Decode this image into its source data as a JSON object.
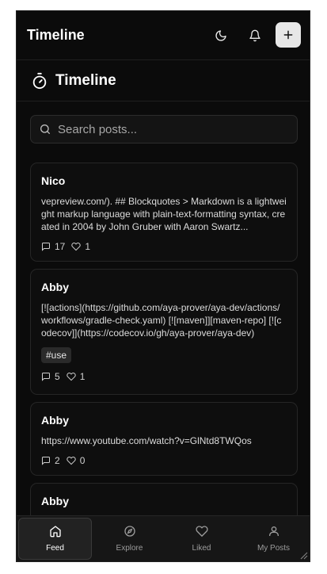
{
  "app": {
    "brand": "Timeline"
  },
  "header": {
    "icons": [
      "moon-icon",
      "bell-icon",
      "plus-icon"
    ]
  },
  "page": {
    "title": "Timeline",
    "title_icon": "stopwatch-icon"
  },
  "search": {
    "placeholder": "Search posts...",
    "value": ""
  },
  "posts": [
    {
      "author": "Nico",
      "body": "vepreview.com/). ## Blockquotes > Markdown is a lightweight markup language with plain-text-formatting syntax, created in 2004 by John Gruber with Aaron Swartz...",
      "tags": [],
      "comments": "17",
      "likes": "1"
    },
    {
      "author": "Abby",
      "body": "[![actions](https://github.com/aya-prover/aya-dev/actions/workflows/gradle-check.yaml) [![maven]][maven-repo] [![codecov]](https://codecov.io/gh/aya-prover/aya-dev)",
      "tags": [
        "#use"
      ],
      "comments": "5",
      "likes": "1"
    },
    {
      "author": "Abby",
      "body": "https://www.youtube.com/watch?v=GlNtd8TWQos",
      "tags": [],
      "comments": "2",
      "likes": "0"
    },
    {
      "author": "Abby",
      "body": "",
      "tags": [],
      "comments": "",
      "likes": ""
    }
  ],
  "nav": {
    "items": [
      {
        "label": "Feed",
        "icon": "home-icon",
        "active": true
      },
      {
        "label": "Explore",
        "icon": "compass-icon",
        "active": false
      },
      {
        "label": "Liked",
        "icon": "heart-icon",
        "active": false
      },
      {
        "label": "My Posts",
        "icon": "user-icon",
        "active": false
      }
    ]
  },
  "colors": {
    "background": "#0b0b0b",
    "card": "#0e0e0e",
    "accent_button": "#e7e7e7",
    "nav_bg": "#161616"
  }
}
